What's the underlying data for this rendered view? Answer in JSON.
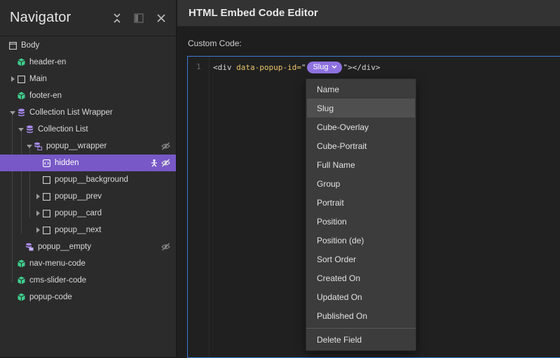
{
  "navigator": {
    "title": "Navigator",
    "tree": [
      {
        "label": "Body",
        "icon": "body-icon",
        "depth": 0,
        "arrow": "none"
      },
      {
        "label": "header-en",
        "icon": "symbol-icon",
        "depth": 1,
        "arrow": "none"
      },
      {
        "label": "Main",
        "icon": "box-icon",
        "depth": 1,
        "arrow": "collapsed"
      },
      {
        "label": "footer-en",
        "icon": "symbol-icon",
        "depth": 1,
        "arrow": "none"
      },
      {
        "label": "Collection List Wrapper",
        "icon": "collection-icon",
        "depth": 1,
        "arrow": "expanded"
      },
      {
        "label": "Collection List",
        "icon": "collection-icon",
        "depth": 2,
        "arrow": "expanded"
      },
      {
        "label": "popup__wrapper",
        "icon": "collection-item-icon",
        "depth": 3,
        "arrow": "expanded",
        "trail": [
          "hidden-eye-icon"
        ]
      },
      {
        "label": "hidden",
        "icon": "embed-icon",
        "depth": 4,
        "arrow": "none",
        "selected": true,
        "trail": [
          "settings-icon",
          "hidden-eye-icon"
        ]
      },
      {
        "label": "popup__background",
        "icon": "box-icon",
        "depth": 4,
        "arrow": "none"
      },
      {
        "label": "popup__prev",
        "icon": "box-icon",
        "depth": 4,
        "arrow": "collapsed"
      },
      {
        "label": "popup__card",
        "icon": "box-icon",
        "depth": 4,
        "arrow": "collapsed"
      },
      {
        "label": "popup__next",
        "icon": "box-icon",
        "depth": 4,
        "arrow": "collapsed"
      },
      {
        "label": "popup__empty",
        "icon": "collection-empty-icon",
        "depth": 2,
        "arrow": "none",
        "trail": [
          "hidden-eye-icon"
        ]
      },
      {
        "label": "nav-menu-code",
        "icon": "symbol-icon",
        "depth": 1,
        "arrow": "none"
      },
      {
        "label": "cms-slider-code",
        "icon": "symbol-icon",
        "depth": 1,
        "arrow": "none"
      },
      {
        "label": "popup-code",
        "icon": "symbol-icon",
        "depth": 1,
        "arrow": "none"
      }
    ]
  },
  "editor": {
    "title": "HTML Embed Code Editor",
    "custom_code_label": "Custom Code:",
    "line_number": "1",
    "code": {
      "open": "<div ",
      "attr": "data-popup-id=",
      "quote_open": "\"",
      "field_pill": "Slug",
      "quote_close": "\"",
      "close": "></div>"
    }
  },
  "dropdown": {
    "items": [
      "Name",
      "Slug",
      "Cube-Overlay",
      "Cube-Portrait",
      "Full Name",
      "Group",
      "Portrait",
      "Position",
      "Position (de)",
      "Sort Order",
      "Created On",
      "Updated On",
      "Published On"
    ],
    "active_index": 1,
    "footer_item": "Delete Field"
  },
  "colors": {
    "accent": "#7758c6",
    "pill": "#8f72e0",
    "symbol_green": "#3ecf8e",
    "collection_purple": "#a98bf0",
    "focus_blue": "#3a7bd5"
  }
}
